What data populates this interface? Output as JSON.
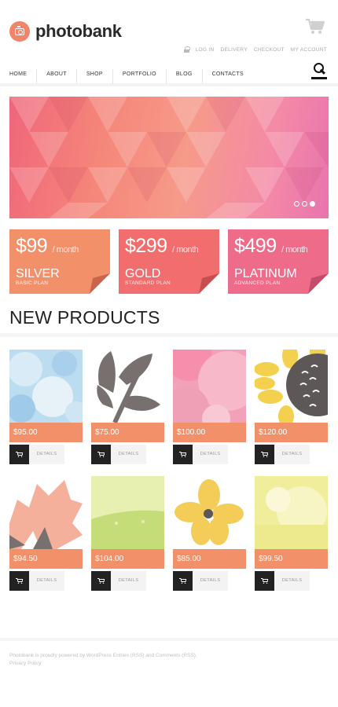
{
  "header": {
    "logo_text": "photobank",
    "user_links": [
      "LOG IN",
      "DELIVERY",
      "CHECKOUT",
      "MY ACCOUNT"
    ]
  },
  "nav": {
    "items": [
      "HOME",
      "ABOUT",
      "SHOP",
      "PORTFOLIO",
      "BLOG",
      "CONTACTS"
    ],
    "active": "HOME"
  },
  "banner": {
    "slides": 3,
    "active_slide": 3
  },
  "plans": [
    {
      "price": "$99",
      "per": "/ month",
      "name": "SILVER",
      "sub": "BASIC PLAN",
      "color": "#f2906a"
    },
    {
      "price": "$299",
      "per": "/ month",
      "name": "GOLD",
      "sub": "STANDARD PLAN",
      "color": "#f26e6e"
    },
    {
      "price": "$499",
      "per": "/ month",
      "name": "PLATINUM",
      "sub": "ADVANCED PLAN",
      "color": "#ef6b8a"
    }
  ],
  "section": {
    "title": "NEW PRODUCTS"
  },
  "products": [
    {
      "price": "$95.00",
      "details": "DETAILS",
      "image": "watercolor-sky"
    },
    {
      "price": "$75.00",
      "details": "DETAILS",
      "image": "grey-leaf"
    },
    {
      "price": "$100.00",
      "details": "DETAILS",
      "image": "pink-balloons"
    },
    {
      "price": "$120.00",
      "details": "DETAILS",
      "image": "sunflower"
    },
    {
      "price": "$94.50",
      "details": "DETAILS",
      "image": "pink-petals"
    },
    {
      "price": "$104.00",
      "details": "DETAILS",
      "image": "green-field"
    },
    {
      "price": "$85.00",
      "details": "DETAILS",
      "image": "yellow-flower"
    },
    {
      "price": "$99.50",
      "details": "DETAILS",
      "image": "yellow-sun"
    }
  ],
  "footer": {
    "line1": "Photobank is proudly powered by WordPress Entries (RSS) and Comments (RSS).",
    "line2": "Privacy Policy"
  },
  "colors": {
    "accent": "#f2846a",
    "price_bar": "#f2906a",
    "dark_button": "#222222"
  }
}
